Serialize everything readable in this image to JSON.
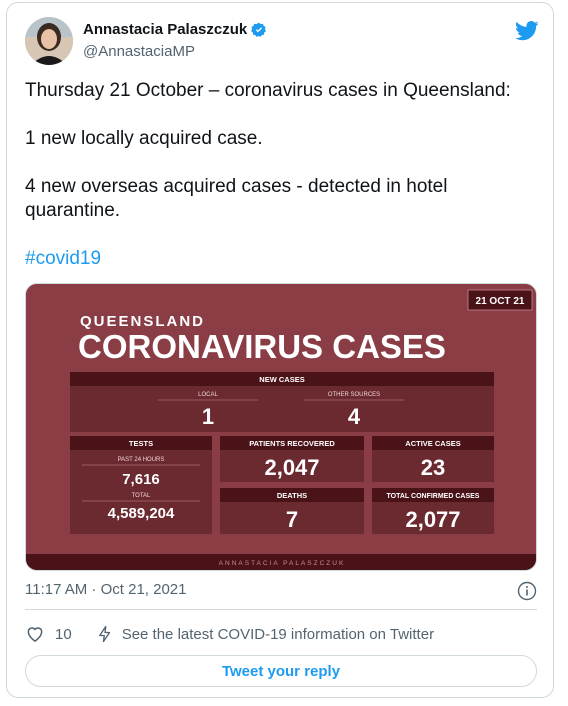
{
  "author": {
    "name": "Annastacia Palaszczuk",
    "handle": "@AnnastaciaMP"
  },
  "tweet": {
    "lines": [
      "Thursday 21 October – coronavirus cases in Queensland:",
      "1 new locally acquired case.",
      "4 new overseas acquired cases - detected in hotel quarantine."
    ],
    "hashtag": "#covid19"
  },
  "graphic": {
    "date": "21 OCT 21",
    "title_small": "QUEENSLAND",
    "title_big": "CORONAVIRUS CASES",
    "new_cases_label": "NEW CASES",
    "local_label": "LOCAL",
    "local_value": "1",
    "other_label": "OTHER SOURCES",
    "other_value": "4",
    "tests_label": "TESTS",
    "past24_label": "PAST 24 HOURS",
    "past24_value": "7,616",
    "total_label": "TOTAL",
    "total_value": "4,589,204",
    "recovered_label": "PATIENTS RECOVERED",
    "recovered_value": "2,047",
    "active_label": "ACTIVE CASES",
    "active_value": "23",
    "deaths_label": "DEATHS",
    "deaths_value": "7",
    "confirmed_label": "TOTAL CONFIRMED CASES",
    "confirmed_value": "2,077",
    "footer": "ANNASTACIA PALASZCZUK"
  },
  "meta": {
    "timestamp": "11:17 AM · Oct 21, 2021",
    "likes": "10",
    "info_link": "See the latest COVID-19 information on Twitter",
    "reply_button": "Tweet your reply"
  },
  "colors": {
    "accent": "#1d9bf0",
    "graphic_bg": "#8a3d45",
    "graphic_panel": "#6b2a30",
    "graphic_header": "#4a1318"
  }
}
